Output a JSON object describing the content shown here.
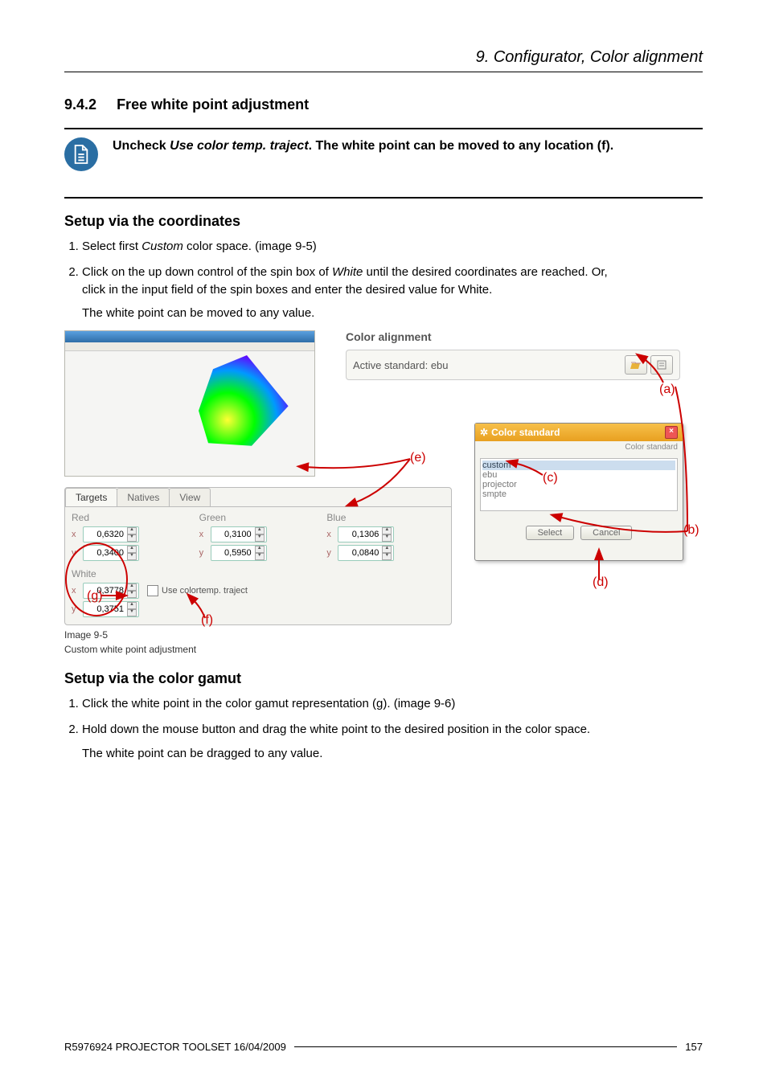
{
  "header": {
    "chapter": "9. Configurator, Color alignment"
  },
  "section": {
    "num": "9.4.2",
    "title": "Free white point adjustment"
  },
  "note": {
    "pre": "Uncheck ",
    "em": "Use color temp. traject",
    "post": ". The white point can be moved to any location (f)."
  },
  "setup1": {
    "title": "Setup via the coordinates",
    "s1a": "Select first ",
    "s1b": "Custom",
    "s1c": " color space. (image 9-5)",
    "s2a": "Click on the up down control of the spin box of ",
    "s2b": "White",
    "s2c": " until the desired coordinates are reached. Or,",
    "s2d": "click in the input field of the spin boxes and enter the desired value for White.",
    "s2e": "The white point can be moved to any value."
  },
  "figure": {
    "caption1": "Image 9-5",
    "caption2": "Custom white point adjustment",
    "colorAlign": "Color alignment",
    "activeStd": "Active standard: ebu",
    "dlgTitle": "Color standard",
    "dlgSub": "Color standard",
    "opts": [
      "custom",
      "ebu",
      "projector",
      "smpte"
    ],
    "tabs": [
      "Targets",
      "Natives",
      "View"
    ],
    "groups": [
      "Red",
      "Green",
      "Blue",
      "White"
    ],
    "vals": {
      "rx": "0,6320",
      "ry": "0,3400",
      "gx": "0,3100",
      "gy": "0,5950",
      "bx": "0,1306",
      "by": "0,0840",
      "wx": "0,3778",
      "wy": "0,3751"
    },
    "chkLabel": "Use colortemp. traject",
    "btnSelect": "Select",
    "btnCancel": "Cancel",
    "ann": {
      "a": "(a)",
      "b": "(b)",
      "c": "(c)",
      "d": "(d)",
      "e": "(e)",
      "f": "(f)",
      "g": "(g)"
    }
  },
  "setup2": {
    "title": "Setup via the color gamut",
    "s1": "Click the white point in the color gamut representation (g). (image 9-6)",
    "s2a": "Hold down the mouse button and drag the white point to the desired position in the color space.",
    "s2b": "The white point can be dragged to any value."
  },
  "footer": {
    "left": "R5976924 PROJECTOR TOOLSET 16/04/2009",
    "right": "157"
  }
}
